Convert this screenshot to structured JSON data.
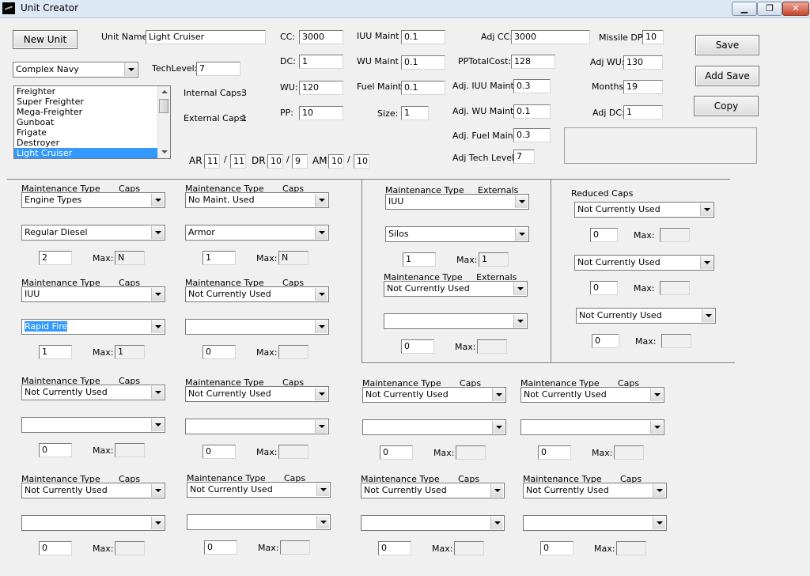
{
  "window": {
    "title": "Unit Creator",
    "min_label": "▁",
    "max_label": "❐",
    "close_label": "✕"
  },
  "top": {
    "new_unit_label": "New Unit",
    "unit_name_label": "Unit Name:",
    "unit_name_value": "Light Cruiser",
    "category_value": "Complex Navy",
    "techlevel_label": "TechLevel:",
    "techlevel_value": "7",
    "internal_caps_label": "Internal Caps:",
    "internal_caps_value": "3",
    "external_caps_label": "External Caps:",
    "external_caps_value": "1",
    "unit_list": [
      "Freighter",
      "Super Freighter",
      "Mega-Freighter",
      "Gunboat",
      "Frigate",
      "Destroyer",
      "Light Cruiser"
    ],
    "ar_label": "AR",
    "ar_value": "11",
    "ar_max": "11",
    "dr_label": "DR",
    "dr_value": "10",
    "dr_max": "9",
    "am_label": "AM",
    "am_value": "10",
    "am_max": "10",
    "slash": "/",
    "cc_label": "CC:",
    "cc_value": "3000",
    "dc_label": "DC:",
    "dc_value": "1",
    "wu_label": "WU:",
    "wu_value": "120",
    "pp_label": "PP:",
    "pp_value": "10",
    "iuu_maint_label": "IUU Maint",
    "iuu_maint_value": "0.1",
    "wu_maint_label": "WU Maint",
    "wu_maint_value": "0.1",
    "fuel_maint_label": "Fuel Maint",
    "fuel_maint_value": "0.1",
    "size_label": "Size:",
    "size_value": "1",
    "adj_cc_label": "Adj CC:",
    "adj_cc_value": "3000",
    "pptotal_label": "PPTotalCost:",
    "pptotal_value": "128",
    "adj_iuu_label": "Adj. IUU Maint:",
    "adj_iuu_value": "0.3",
    "adj_wu_maint_label": "Adj. WU Maint:",
    "adj_wu_maint_value": "0.1",
    "adj_fuel_label": "Adj. Fuel Maint:",
    "adj_fuel_value": "0.3",
    "adj_tech_label": "Adj Tech Level:",
    "adj_tech_value": "7",
    "missile_dp_label": "Missile DP:",
    "missile_dp_value": "10",
    "adj_wu_label": "Adj WU:",
    "adj_wu_value": "130",
    "months_label": "Months:",
    "months_value": "19",
    "adj_dc_label": "Adj DC:",
    "adj_dc_value": "1",
    "save_label": "Save",
    "add_save_label": "Add Save",
    "copy_label": "Copy"
  },
  "common": {
    "mt_label": "Maintenance Type",
    "caps_label": "Caps",
    "ext_label": "Externals",
    "max_label": "Max:"
  },
  "left_groups": [
    {
      "type": "Engine Types",
      "sub": "Regular Diesel",
      "qty": "2",
      "max": "N"
    },
    {
      "type": "No Maint. Used",
      "sub": "Armor",
      "qty": "1",
      "max": "N"
    },
    {
      "type": "IUU",
      "sub": "Rapid Fire",
      "qty": "1",
      "max": "1"
    },
    {
      "type": "Not Currently Used",
      "sub": "",
      "qty": "0",
      "max": ""
    },
    {
      "type": "Not Currently Used",
      "sub": "",
      "qty": "0",
      "max": ""
    },
    {
      "type": "Not Currently Used",
      "sub": "",
      "qty": "0",
      "max": ""
    },
    {
      "type": "Not Currently Used",
      "sub": "",
      "qty": "0",
      "max": ""
    },
    {
      "type": "Not Currently Used",
      "sub": "",
      "qty": "0",
      "max": ""
    }
  ],
  "externals": [
    {
      "type": "IUU",
      "sub": "Silos",
      "qty": "1",
      "max": "1"
    },
    {
      "type": "Not Currently Used",
      "sub": "",
      "qty": "0",
      "max": ""
    }
  ],
  "reduced": {
    "label": "Reduced Caps",
    "items": [
      {
        "type": "Not Currently Used",
        "qty": "0",
        "max": ""
      },
      {
        "type": "Not Currently Used",
        "qty": "0",
        "max": ""
      },
      {
        "type": "Not Currently Used",
        "qty": "0",
        "max": ""
      }
    ]
  },
  "bottom_groups": [
    {
      "type": "Not Currently Used",
      "sub": "",
      "qty": "0",
      "max": ""
    },
    {
      "type": "Not Currently Used",
      "sub": "",
      "qty": "0",
      "max": ""
    },
    {
      "type": "Not Currently Used",
      "sub": "",
      "qty": "0",
      "max": ""
    },
    {
      "type": "Not Currently Used",
      "sub": "",
      "qty": "0",
      "max": ""
    }
  ]
}
